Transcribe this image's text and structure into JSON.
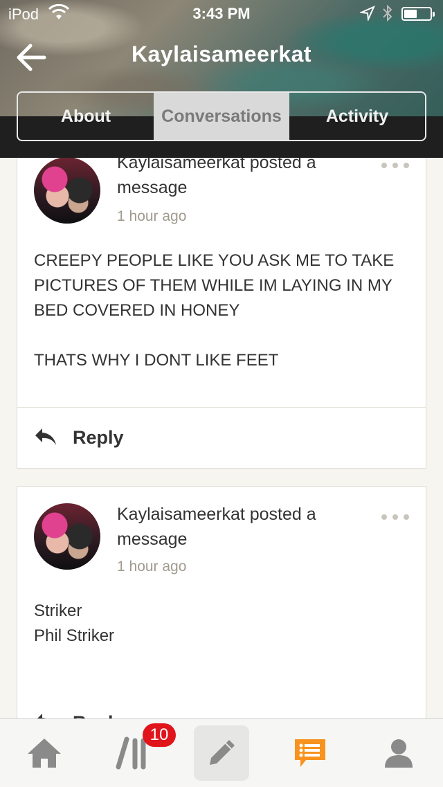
{
  "status_bar": {
    "carrier": "iPod",
    "time": "3:43 PM"
  },
  "header": {
    "title": "Kaylaisameerkat",
    "tabs": [
      {
        "label": "About",
        "active": false
      },
      {
        "label": "Conversations",
        "active": true
      },
      {
        "label": "Activity",
        "active": false
      }
    ]
  },
  "posts": [
    {
      "headline": "Kaylaisameerkat posted a message",
      "time": "1 hour ago",
      "lines": [
        "CREEPY PEOPLE LIKE YOU ASK ME TO TAKE PICTURES OF THEM WHILE IM LAYING IN MY BED COVERED IN HONEY",
        "THATS WHY I DONT LIKE FEET"
      ],
      "reply_label": "Reply"
    },
    {
      "headline": "Kaylaisameerkat posted a message",
      "time": "1 hour ago",
      "lines": [
        "Striker",
        "Phil Striker"
      ],
      "reply_label": "Reply"
    }
  ],
  "tabbar": {
    "library_badge": "10",
    "accent_color": "#f7931e",
    "icon_color": "#8a8a8a"
  }
}
